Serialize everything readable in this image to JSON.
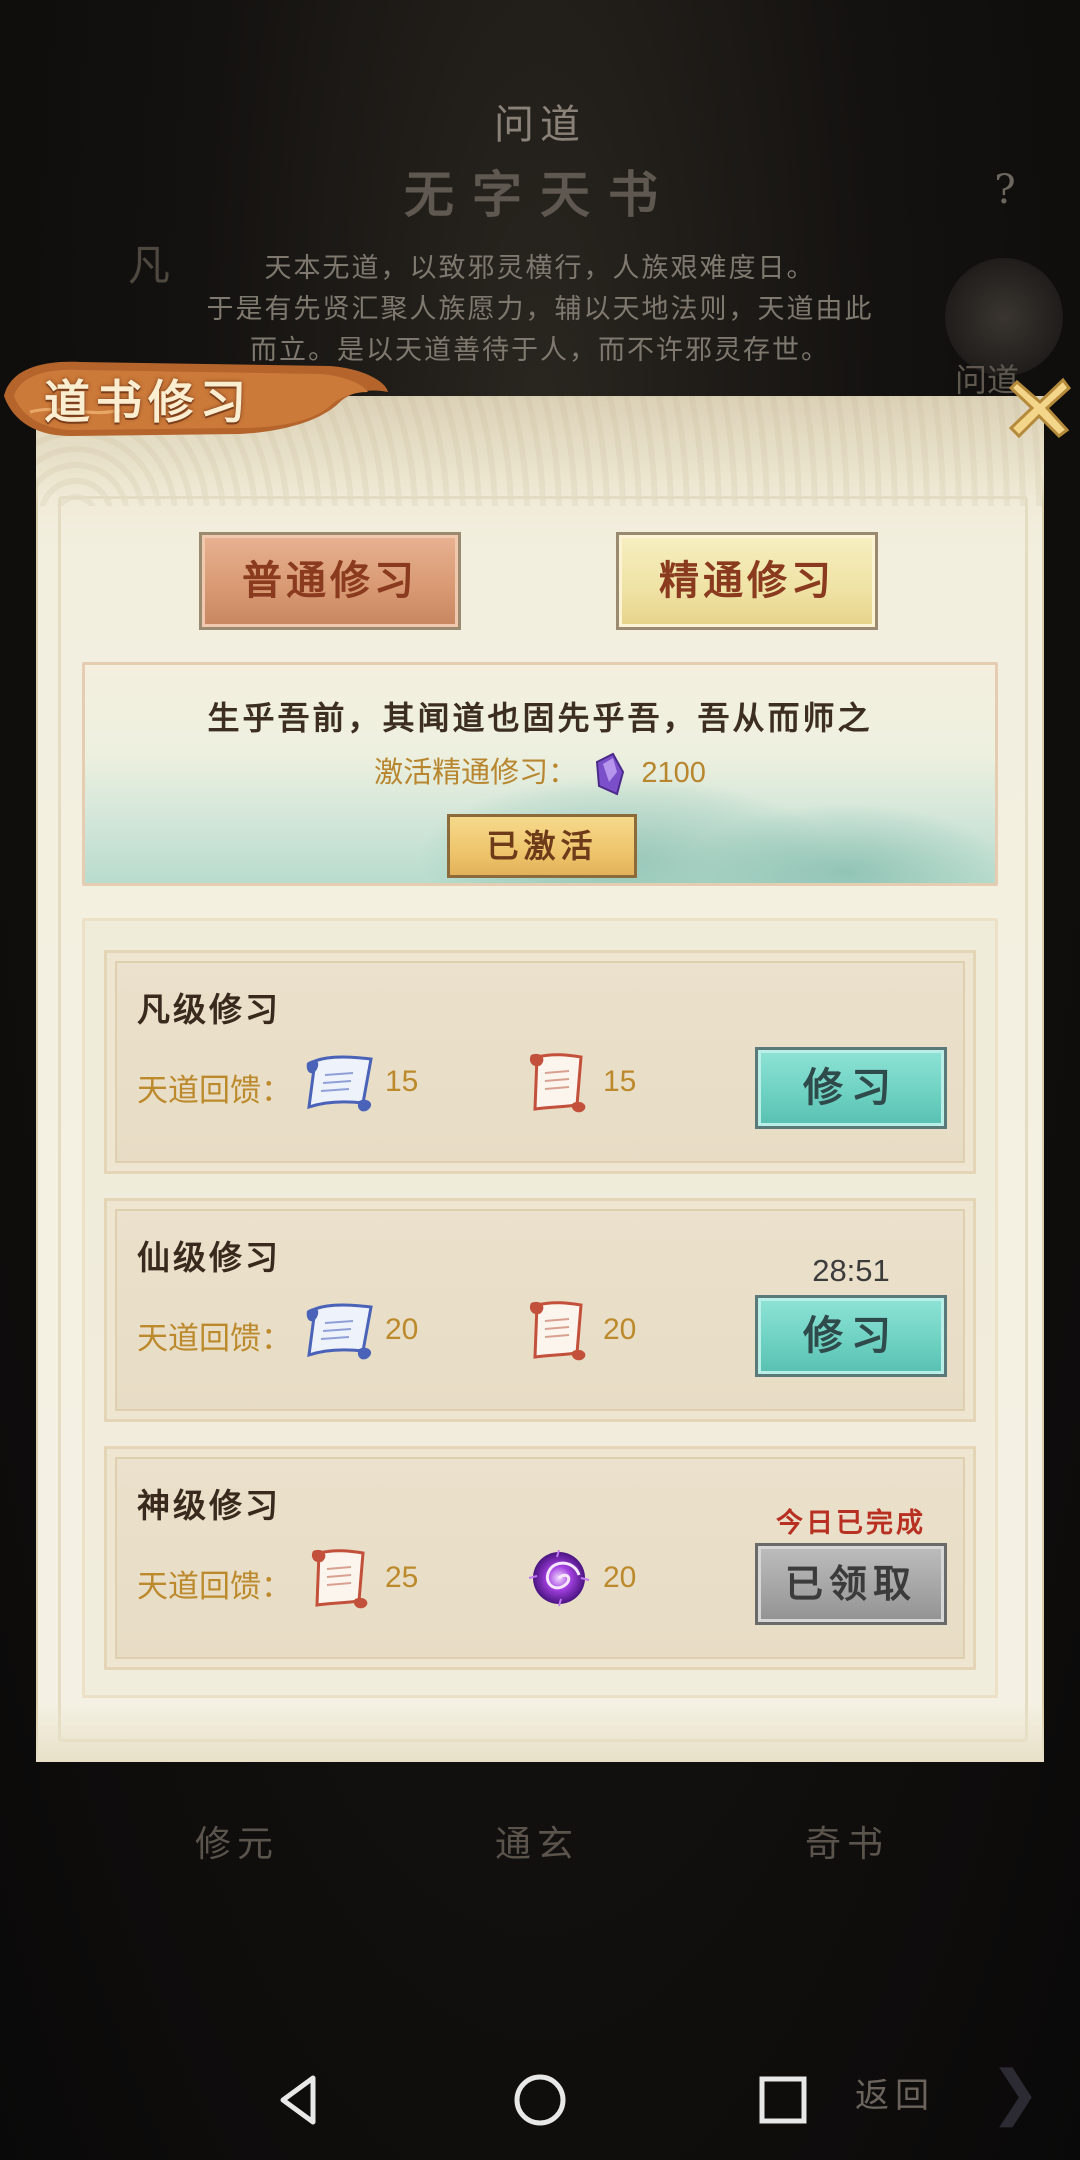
{
  "background": {
    "header_small": "问道",
    "header_title": "无字天书",
    "help_glyph": "?",
    "side_char": "凡",
    "description_lines": [
      "天本无道，以致邪灵横行，人族艰难度日。",
      "于是有先贤汇聚人族愿力，辅以天地法则，天道由此",
      "而立。是以天道善待于人，而不许邪灵存世。"
    ],
    "avatar_label": "问道",
    "bottom_tabs": [
      "修元",
      "通玄",
      "奇书"
    ],
    "back_label": "返回"
  },
  "dialog": {
    "title": "道书修习",
    "close_icon": "close-x-icon",
    "tabs": [
      {
        "label": "普通修习",
        "state": "selected"
      },
      {
        "label": "精通修习",
        "state": "normal"
      }
    ],
    "activation": {
      "motto": "生乎吾前，其闻道也固先乎吾，吾从而师之",
      "cost_label": "激活精通修习：",
      "cost_icon": "purple-crystal-icon",
      "cost_value": "2100",
      "status_button": "已激活"
    },
    "tiers": [
      {
        "name": "凡级修习",
        "reward_label": "天道回馈：",
        "rewards": [
          {
            "icon": "blue-scroll-icon",
            "qty": "15"
          },
          {
            "icon": "red-scroll-icon",
            "qty": "15"
          }
        ],
        "timer": "",
        "note": "",
        "button": "修习",
        "button_state": "available"
      },
      {
        "name": "仙级修习",
        "reward_label": "天道回馈：",
        "rewards": [
          {
            "icon": "blue-scroll-icon",
            "qty": "20"
          },
          {
            "icon": "red-scroll-icon",
            "qty": "20"
          }
        ],
        "timer": "28:51",
        "note": "",
        "button": "修习",
        "button_state": "available"
      },
      {
        "name": "神级修习",
        "reward_label": "天道回馈：",
        "rewards": [
          {
            "icon": "red-scroll-icon",
            "qty": "25"
          },
          {
            "icon": "purple-vortex-orb-icon",
            "qty": "20"
          }
        ],
        "timer": "",
        "note": "今日已完成",
        "button": "已领取",
        "button_state": "claimed"
      }
    ]
  },
  "system_nav": {
    "back_icon": "triangle-back-icon",
    "home_icon": "circle-home-icon",
    "recent_icon": "square-recents-icon"
  },
  "colors": {
    "dialog_bg": "#f4f1e4",
    "reward_text": "#bc8a2c",
    "study_button": "#6fd2c3",
    "claimed_button": "#a4a4a4",
    "done_note": "#b83022",
    "tab_selected": "#d99a74",
    "tab_normal": "#efe2a4"
  }
}
